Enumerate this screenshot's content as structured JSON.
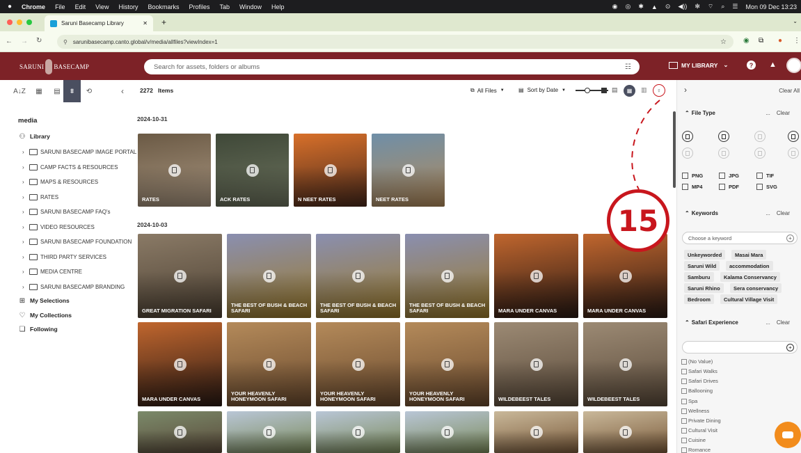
{
  "os_menubar": {
    "app": "Chrome",
    "menus": [
      "File",
      "Edit",
      "View",
      "History",
      "Bookmarks",
      "Profiles",
      "Tab",
      "Window",
      "Help"
    ],
    "clock": "Mon 09 Dec 13:23"
  },
  "browser": {
    "tab_title": "Saruni Basecamp Library",
    "new_tab": "+",
    "url": "sarunibasecamp.canto.global/v/media/allfiles?viewIndex=1"
  },
  "header": {
    "logo_left": "SARUNI",
    "logo_right": "BASECAMP",
    "search_placeholder": "Search for assets, folders or albums",
    "my_library": "MY LIBRARY"
  },
  "sidebar": {
    "section_title": "media",
    "library_label": "Library",
    "folders": [
      "SARUNI BASECAMP IMAGE PORTAL",
      "CAMP FACTS & RESOURCES",
      "MAPS & RESOURCES",
      "RATES",
      "SARUNI BASECAMP FAQ's",
      "VIDEO RESOURCES",
      "SARUNI BASECAMP FOUNDATION",
      "THIRD PARTY SERVICES",
      "MEDIA CENTRE",
      "SARUNI BASECAMP BRANDING"
    ],
    "links": [
      "My Selections",
      "My Collections",
      "Following"
    ]
  },
  "toolbar": {
    "count": "2272",
    "items_label": "Items",
    "all_files": "All Files",
    "sort": "Sort by Date"
  },
  "groups": [
    {
      "date": "2024-10-31"
    },
    {
      "date": "2024-10-03"
    }
  ],
  "thumbs": [
    {
      "title": "RATES",
      "c1": "#6b5a45",
      "c2": "#a99680"
    },
    {
      "title": "ACK RATES",
      "c1": "#3f4838",
      "c2": "#6d735e"
    },
    {
      "title": "N NEET RATES",
      "c1": "#d8702a",
      "c2": "#4a2a1c"
    },
    {
      "title": "NEET RATES",
      "c1": "#6f8fa8",
      "c2": "#b28a5a"
    },
    {
      "title": "GREAT MIGRATION SAFARI",
      "c1": "#8a7a66",
      "c2": "#4d4133"
    },
    {
      "title": "THE BEST OF BUSH & BEACH SAFARI",
      "c1": "#8a8fb0",
      "c2": "#9b7a2a"
    },
    {
      "title": "THE BEST OF BUSH & BEACH SAFARI",
      "c1": "#8a8fb0",
      "c2": "#9b7a2a"
    },
    {
      "title": "THE BEST OF BUSH & BEACH SAFARI",
      "c1": "#8a8fb0",
      "c2": "#9b7a2a"
    },
    {
      "title": "MARA UNDER CANVAS",
      "c1": "#c0662e",
      "c2": "#2a1a14"
    },
    {
      "title": "MARA UNDER CANVAS",
      "c1": "#c0662e",
      "c2": "#2a1a14"
    },
    {
      "title": "MARA UNDER CANVAS",
      "c1": "#c0662e",
      "c2": "#2a1a14"
    },
    {
      "title": "YOUR HEAVENLY HONEYMOON SAFARI",
      "c1": "#b48a5a",
      "c2": "#6a4a2e"
    },
    {
      "title": "YOUR HEAVENLY HONEYMOON SAFARI",
      "c1": "#b48a5a",
      "c2": "#6a4a2e"
    },
    {
      "title": "YOUR HEAVENLY HONEYMOON SAFARI",
      "c1": "#b48a5a",
      "c2": "#6a4a2e"
    },
    {
      "title": "WILDEBEEST TALES",
      "c1": "#9c8a74",
      "c2": "#5a4a3a"
    },
    {
      "title": "WILDEBEEST TALES",
      "c1": "#9c8a74",
      "c2": "#5a4a3a"
    },
    {
      "title": "",
      "c1": "#7b8a6a",
      "c2": "#5a4a3a"
    },
    {
      "title": "",
      "c1": "#b9c6d6",
      "c2": "#7a8a5a"
    },
    {
      "title": "",
      "c1": "#b9c6d6",
      "c2": "#7a8a5a"
    },
    {
      "title": "",
      "c1": "#b9c6d6",
      "c2": "#7a8a5a"
    },
    {
      "title": "",
      "c1": "#c9b89a",
      "c2": "#7a5a3a"
    },
    {
      "title": "",
      "c1": "#c9b89a",
      "c2": "#7a5a3a"
    }
  ],
  "annotation": {
    "number": "15",
    "color": "#c8161d"
  },
  "filters": {
    "clear_all": "Clear All",
    "more": "...",
    "clear": "Clear",
    "file_type": {
      "title": "File Type",
      "options": [
        "PNG",
        "JPG",
        "TIF",
        "MP4",
        "PDF",
        "SVG"
      ]
    },
    "keywords": {
      "title": "Keywords",
      "placeholder": "Choose a keyword",
      "tags": [
        "Unkeyworded",
        "Masai Mara",
        "Saruni Wild",
        "accommodation",
        "Samburu",
        "Kalama Conservancy",
        "Saruni Rhino",
        "Sera conservancy",
        "Bedroom",
        "Cultural Village Visit"
      ]
    },
    "safari": {
      "title": "Safari Experience",
      "options": [
        "(No Value)",
        "Safari Walks",
        "Safari Drives",
        "Ballooning",
        "Spa",
        "Wellness",
        "Private Dining",
        "Cultural Visit",
        "Cuisine",
        "Romance"
      ]
    }
  },
  "colors": {
    "brand": "#7d2227",
    "chat": "#f28c1c"
  }
}
